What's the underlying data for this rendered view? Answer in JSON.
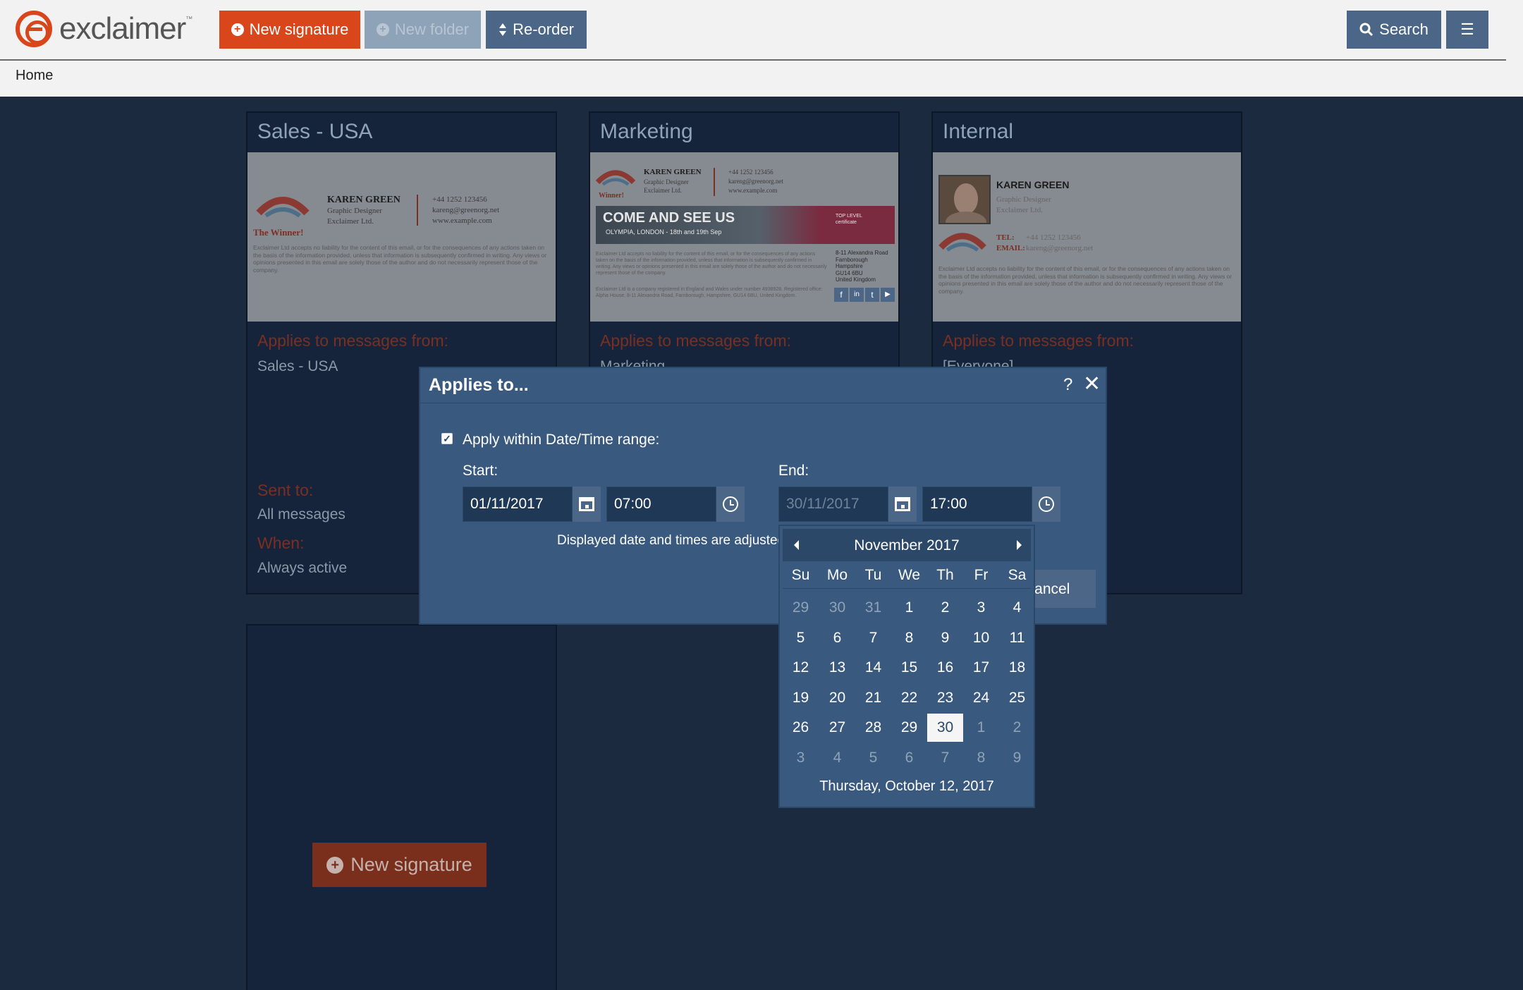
{
  "app": {
    "logo_text": "exclaimer",
    "logo_tm": "™"
  },
  "toolbar": {
    "new_signature": "New signature",
    "new_folder": "New folder",
    "reorder": "Re-order",
    "search": "Search",
    "menu_icon": "☰"
  },
  "breadcrumb": {
    "home": "Home"
  },
  "cards": [
    {
      "title": "Sales - USA",
      "applies_label": "Applies to messages from:",
      "applies_value": "Sales - USA",
      "sent_label": "Sent to:",
      "sent_value": "All messages",
      "when_label": "When:",
      "when_value": "Always active"
    },
    {
      "title": "Marketing",
      "applies_label": "Applies to messages from:",
      "applies_value": "Marketing"
    },
    {
      "title": "Internal",
      "applies_label": "Applies to messages from:",
      "applies_value": "[Everyone]"
    }
  ],
  "previews": {
    "sales": {
      "logo": "GREENORG",
      "winner": "The Winner!",
      "name": "KAREN GREEN",
      "role": "Graphic Designer",
      "company": "Exclaimer Ltd.",
      "phone": "+44 1252 123456",
      "email": "kareng@greenorg.net",
      "web": "www.example.com",
      "disclaimer": "Exclaimer Ltd accepts no liability for the content of this email, or for the consequences of any actions taken on the basis of the information provided, unless that information is subsequently confirmed in writing. Any views or opinions presented in this email are solely those of the author and do not necessarily represent those of the company."
    },
    "marketing": {
      "logo": "GREENORG",
      "winner": "Winner!",
      "name": "KAREN GREEN",
      "role": "Graphic Designer",
      "company": "Exclaimer Ltd.",
      "phone": "+44 1252 123456",
      "email": "kareng@greenorg.net",
      "web": "www.example.com",
      "banner_title": "COME AND SEE US",
      "banner_sub": "OLYMPIA, LONDON - 18th and 19th Sep",
      "banner_badge": "TOP LEVEL certificate",
      "address": "8-11 Alexandra Road\nFarnborough\nHampshire\nGU14 6BU\nUnited Kingdom",
      "disclaimer": "Exclaimer Ltd accepts no liability for the content of this email, or for the consequences of any actions taken on the basis of the information provided, unless that information is subsequently confirmed in writing. Any views or opinions presented in this email are solely those of the author and do not necessarily represent those of the company.",
      "registered": "Exclaimer Ltd is a company registered in England and Wales under number 4938928. Registered office: Alpha House, 8-11 Alexandra Road, Farnborough, Hampshire, GU14 6BU, United Kingdom.",
      "social": [
        "f",
        "in",
        "t",
        "▶"
      ]
    },
    "internal": {
      "logo": "GREENORG",
      "name": "KAREN GREEN",
      "role": "Graphic Designer",
      "company": "Exclaimer Ltd.",
      "tel_label": "TEL:",
      "tel": "+44 1252 123456",
      "email_label": "EMAIL:",
      "email": "kareng@greenorg.net",
      "disclaimer": "Exclaimer Ltd accepts no liability for the content of this email, or for the consequences of any actions taken on the basis of the information provided, unless that information is subsequently confirmed in writing. Any views or opinions presented in this email are solely those of the author and do not necessarily represent those of the company."
    }
  },
  "new_signature_bottom": "New signature",
  "dialog": {
    "title": "Applies to...",
    "help": "?",
    "close": "✕",
    "checkbox_checked": true,
    "checkbox_label": "Apply within Date/Time range:",
    "start_label": "Start:",
    "start_date": "01/11/2017",
    "start_time": "07:00",
    "end_label": "End:",
    "end_date": "30/11/2017",
    "end_time": "17:00",
    "tz_note": "Displayed date and times are adjusted",
    "cancel": "Cancel"
  },
  "calendar": {
    "month": "November 2017",
    "dow": [
      "Su",
      "Mo",
      "Tu",
      "We",
      "Th",
      "Fr",
      "Sa"
    ],
    "weeks": [
      [
        "29",
        "30",
        "31",
        "1",
        "2",
        "3",
        "4"
      ],
      [
        "5",
        "6",
        "7",
        "8",
        "9",
        "10",
        "11"
      ],
      [
        "12",
        "13",
        "14",
        "15",
        "16",
        "17",
        "18"
      ],
      [
        "19",
        "20",
        "21",
        "22",
        "23",
        "24",
        "25"
      ],
      [
        "26",
        "27",
        "28",
        "29",
        "30",
        "1",
        "2"
      ],
      [
        "3",
        "4",
        "5",
        "6",
        "7",
        "8",
        "9"
      ]
    ],
    "muted": [
      [
        0,
        0
      ],
      [
        0,
        1
      ],
      [
        0,
        2
      ],
      [
        4,
        5
      ],
      [
        4,
        6
      ],
      [
        5,
        0
      ],
      [
        5,
        1
      ],
      [
        5,
        2
      ],
      [
        5,
        3
      ],
      [
        5,
        4
      ],
      [
        5,
        5
      ],
      [
        5,
        6
      ]
    ],
    "selected": [
      4,
      4
    ],
    "footer": "Thursday, October 12, 2017"
  }
}
